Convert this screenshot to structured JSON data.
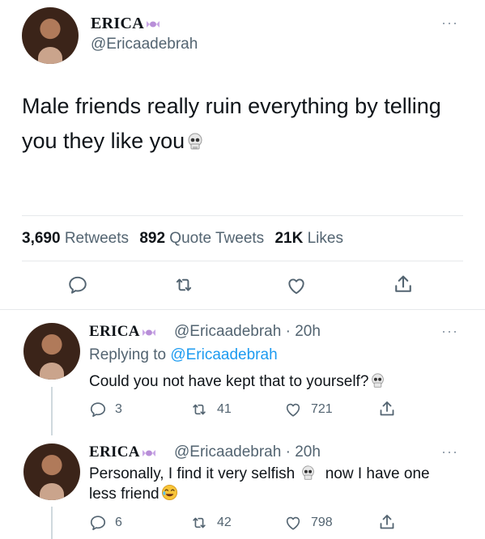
{
  "tweet": {
    "display_name": "ERICA",
    "handle": "@Ericaadebrah",
    "text": "Male friends really ruin everything by telling you they like you",
    "stats": {
      "retweets_count": "3,690",
      "retweets_label": "Retweets",
      "quotes_count": "892",
      "quotes_label": "Quote Tweets",
      "likes_count": "21K",
      "likes_label": "Likes"
    }
  },
  "replies": [
    {
      "display_name": "ERICA",
      "meta": "@Ericaadebrah · 20h",
      "replying_prefix": "Replying to",
      "replying_handle": "@Ericaadebrah",
      "text": "Could you not have kept that to yourself?",
      "reply_count": "3",
      "retweet_count": "41",
      "like_count": "721"
    },
    {
      "display_name": "ERICA",
      "meta": "@Ericaadebrah · 20h",
      "text_part1": "Personally, I find it very selfish",
      "text_part2": "now I have one",
      "text_line2": "less friend",
      "reply_count": "6",
      "retweet_count": "42",
      "like_count": "798"
    }
  ],
  "icons": [
    "reply-icon",
    "retweet-icon",
    "like-icon",
    "share-icon",
    "more-icon",
    "skull-emoji",
    "candy-emoji",
    "laughing-emoji"
  ],
  "colors": {
    "text": "#0f1419",
    "secondary": "#536471",
    "link": "#1d9bf0",
    "divider": "#e6e9eb"
  }
}
